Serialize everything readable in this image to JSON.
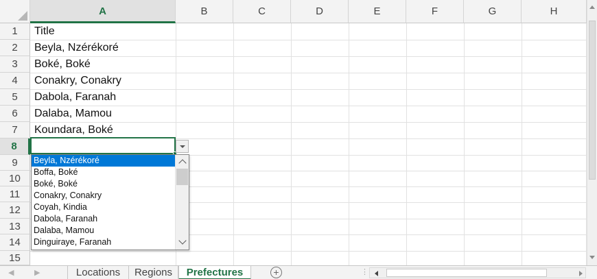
{
  "column_headers": [
    "A",
    "B",
    "C",
    "D",
    "E",
    "F",
    "G",
    "H"
  ],
  "row_headers": [
    "1",
    "2",
    "3",
    "4",
    "5",
    "6",
    "7",
    "8",
    "9",
    "10",
    "11",
    "12",
    "13",
    "14",
    "15"
  ],
  "cells": [
    "Title",
    "Beyla, Nzérékoré",
    "Boké, Boké",
    "Conakry, Conakry",
    "Dabola, Faranah",
    "Dalaba, Mamou",
    "Koundara, Boké"
  ],
  "active_cell": {
    "column": "A",
    "row": "8",
    "value": ""
  },
  "dropdown": {
    "items": [
      "Beyla, Nzérékoré",
      "Boffa, Boké",
      "Boké, Boké",
      "Conakry, Conakry",
      "Coyah, Kindia",
      "Dabola, Faranah",
      "Dalaba, Mamou",
      "Dinguiraye, Faranah"
    ],
    "selected": "Beyla, Nzérékoré"
  },
  "sheet_tabs": [
    {
      "label": "Locations",
      "active": false
    },
    {
      "label": "Regions",
      "active": false
    },
    {
      "label": "Prefectures",
      "active": true
    }
  ],
  "add_sheet_label": "+",
  "icons": {
    "select_all": "select-all-triangle-icon",
    "dropdown_arrow": "dropdown-arrow-icon",
    "add_sheet": "plus-circle-icon",
    "scroll_left": "scroll-left-arrow-icon",
    "scroll_right": "scroll-right-arrow-icon"
  },
  "colors": {
    "accent_green": "#217346",
    "selection_blue": "#0078d7",
    "header_bg": "#f3f3f3",
    "gridline": "#e1e1e1"
  }
}
